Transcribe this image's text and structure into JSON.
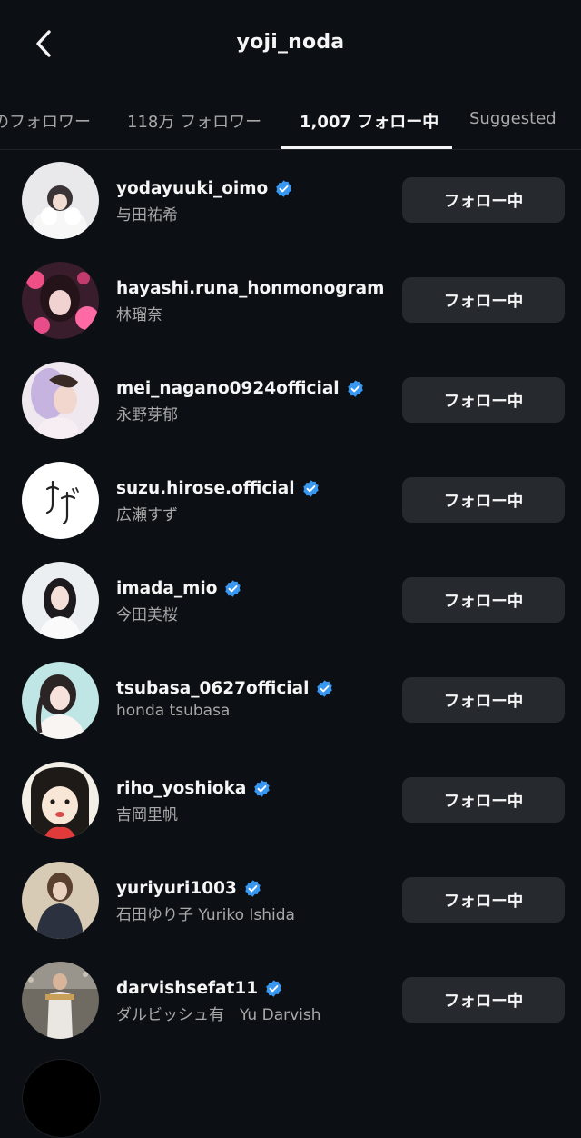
{
  "header": {
    "title": "yoji_noda"
  },
  "tabs": [
    {
      "label": "のフォロワー"
    },
    {
      "label": "118万 フォロワー"
    },
    {
      "label": "1,007 フォロー中"
    },
    {
      "label": "Suggested"
    }
  ],
  "following_button_label": "フォロー中",
  "accounts": [
    {
      "username": "yodayuuki_oimo",
      "fullname": "与田祐希",
      "verified": true
    },
    {
      "username": "hayashi.runa_honmonogram",
      "fullname": "林瑠奈",
      "verified": false
    },
    {
      "username": "mei_nagano0924official",
      "fullname": "永野芽郁",
      "verified": true
    },
    {
      "username": "suzu.hirose.official",
      "fullname": "広瀬すず",
      "verified": true
    },
    {
      "username": "imada_mio",
      "fullname": "今田美桜",
      "verified": true
    },
    {
      "username": "tsubasa_0627official",
      "fullname": "honda tsubasa",
      "verified": true
    },
    {
      "username": "riho_yoshioka",
      "fullname": "吉岡里帆",
      "verified": true
    },
    {
      "username": "yuriyuri1003",
      "fullname": "石田ゆり子  Yuriko Ishida",
      "verified": true
    },
    {
      "username": "darvishsefat11",
      "fullname": "ダルビッシュ有　Yu Darvish",
      "verified": true
    }
  ],
  "colors": {
    "background": "#0c1014",
    "button_bg": "#262a2f",
    "verified_blue": "#3897f0",
    "secondary_text": "#a8a8a8"
  }
}
